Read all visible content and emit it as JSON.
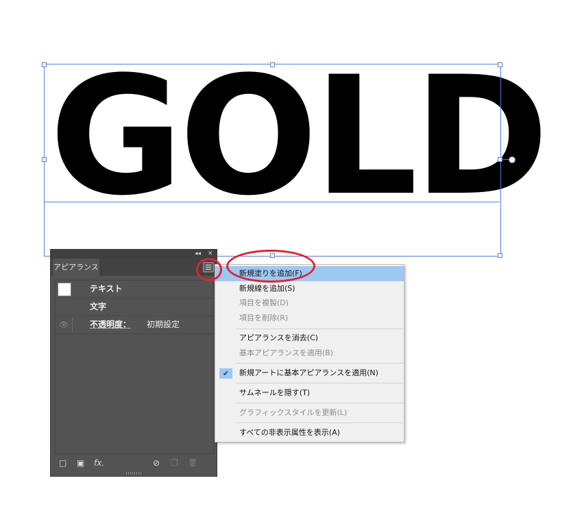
{
  "artwork": {
    "text": "GOLD"
  },
  "panel": {
    "collapse_glyph": "◂◂",
    "close_glyph": "✕",
    "tab_label": "アピアランス",
    "rows": {
      "text_type": "テキスト",
      "characters": "文字",
      "opacity_label": "不透明度：",
      "opacity_value": "初期設定"
    },
    "bottom_icons": {
      "add_stroke": "□",
      "add_fill": "▣",
      "fx": "fx.",
      "clear": "⊘",
      "duplicate": "❐",
      "delete": "🗑"
    }
  },
  "menu": {
    "items": [
      "新規塗りを追加(F)",
      "新規線を追加(S)",
      "項目を複製(D)",
      "項目を削除(R)",
      "アピアランスを消去(C)",
      "基本アピアランスを適用(B)",
      "新規アートに基本アピアランスを適用(N)",
      "サムネールを隠す(T)",
      "グラフィックスタイルを更新(L)",
      "すべての非表示属性を表示(A)"
    ],
    "checkmark": "✔"
  },
  "colors": {
    "highlight": "#9ec7f1",
    "annotation_red": "#dc2434",
    "selection_blue": "#4f7fd6",
    "panel_bg": "#535353"
  }
}
